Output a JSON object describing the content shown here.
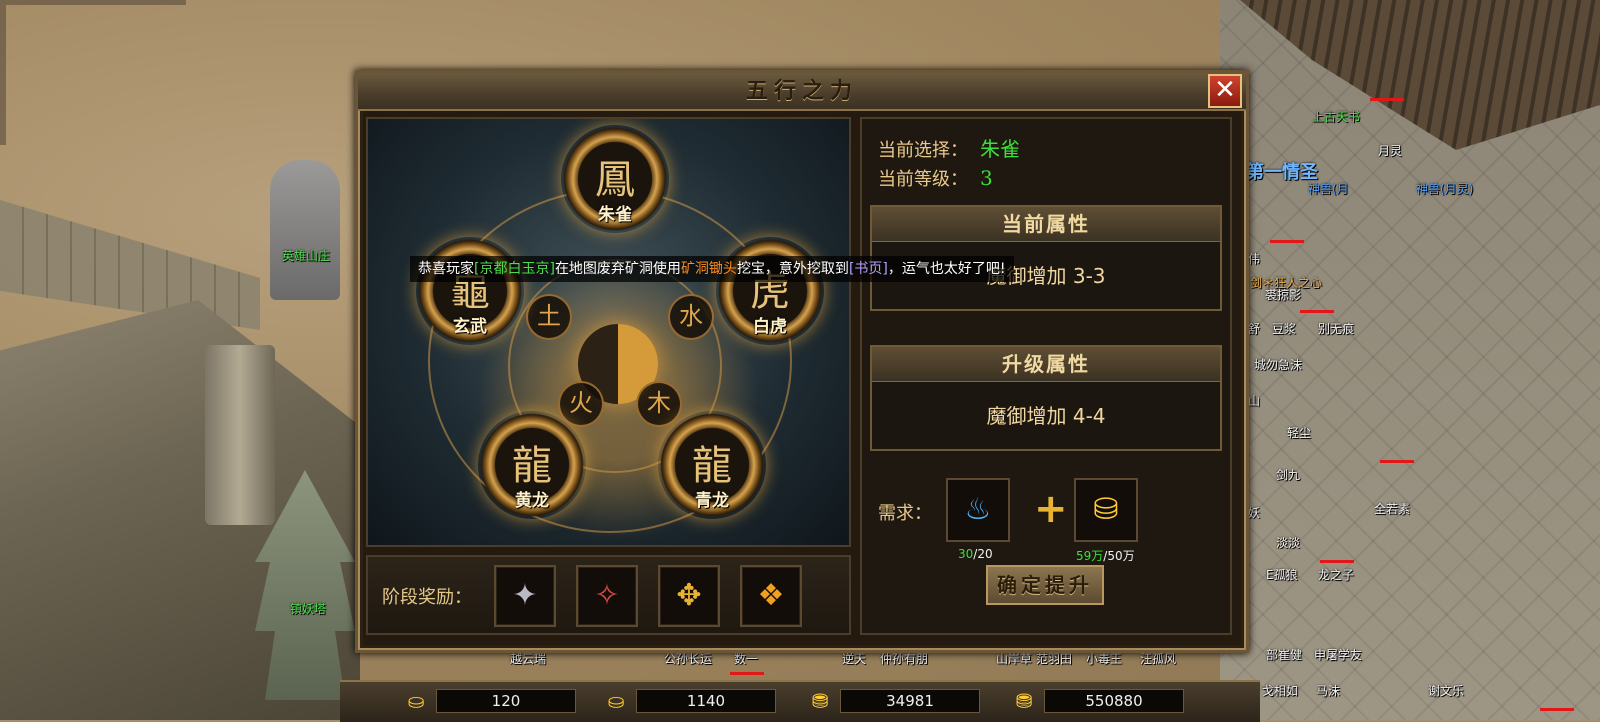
{
  "dialog": {
    "title": "五行之力",
    "close_label": "✕",
    "selected_label": "当前选择：",
    "selected_value": "朱雀",
    "level_label": "当前等级：",
    "level_value": "3",
    "current_attr_title": "当前属性",
    "current_attr_value": "魔御增加 3-3",
    "upgrade_attr_title": "升级属性",
    "upgrade_attr_value": "魔御增加 4-4",
    "require_label": "需求：",
    "requirements": [
      {
        "icon": "blue-flame-icon",
        "have": "30",
        "need": "/20"
      },
      {
        "icon": "gold-ingot-icon",
        "have": "59万",
        "need": "/50万"
      }
    ],
    "confirm_label": "确定提升",
    "reward_label": "阶段奖励："
  },
  "elements": [
    {
      "name": "朱雀",
      "icon": "phoenix-icon",
      "glyph": "鳳"
    },
    {
      "name": "白虎",
      "icon": "tiger-icon",
      "glyph": "虎"
    },
    {
      "name": "青龙",
      "icon": "azure-dragon-icon",
      "glyph": "龍"
    },
    {
      "name": "黄龙",
      "icon": "yellow-dragon-icon",
      "glyph": "龍"
    },
    {
      "name": "玄武",
      "icon": "tortoise-icon",
      "glyph": "龜"
    }
  ],
  "broadcast": {
    "p1": "恭喜玩家",
    "player": "[京都白玉京]",
    "p2": "在地图废弃矿洞使用",
    "item": "矿洞锄头",
    "p3": "挖宝，意外挖取到",
    "loot": "[书页]",
    "p4": "，运气也太好了吧!"
  },
  "currency": [
    {
      "icon": "ingot-icon",
      "value": "120"
    },
    {
      "icon": "locked-ingot-icon",
      "value": "1140"
    },
    {
      "icon": "gold-pile-icon",
      "value": "34981"
    },
    {
      "icon": "locked-gold-icon",
      "value": "550880"
    }
  ],
  "map_labels": {
    "hero_villa": "英雄山庄",
    "demon_tower": "镇妖塔",
    "ancient_book": "上古天书"
  },
  "players": [
    "月灵",
    "神兽(月灵)",
    "神兽(月",
    "第一情圣",
    "伟",
    "裘掠影",
    "舒",
    "豆浆",
    "别无痕",
    "城勿急沫",
    "山",
    "轻尘",
    "剑九",
    "全若素",
    "淡淡",
    "E孤狼",
    "龙之子",
    "部崔健",
    "申屠学友",
    "戈相如",
    "马沫",
    "谢文乐",
    "剑＊狂人之心",
    "妖",
    "越云瑞",
    "公孙长运",
    "数一",
    "逆天",
    "仲孙有朋",
    "山岸草",
    "范羽田",
    "小毒王",
    "汪孤风"
  ]
}
